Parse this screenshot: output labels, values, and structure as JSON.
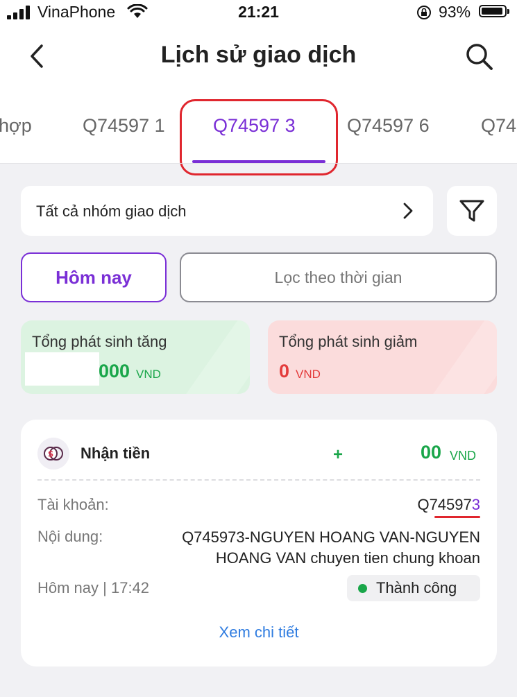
{
  "status_bar": {
    "carrier": "VinaPhone",
    "time": "21:21",
    "battery": "93%",
    "battery_level": 0.93,
    "icons": [
      "signal-icon",
      "wifi-icon",
      "orientation-lock-icon",
      "battery-icon"
    ]
  },
  "header": {
    "title": "Lịch sử giao dịch",
    "back_icon": "chevron-left-icon",
    "search_icon": "search-icon"
  },
  "tabs": [
    {
      "label": "hợp",
      "active": false
    },
    {
      "label": "Q74597 1",
      "active": false
    },
    {
      "label": "Q74597 3",
      "active": true
    },
    {
      "label": "Q74597 6",
      "active": false
    },
    {
      "label": "Q74",
      "active": false
    }
  ],
  "filters": {
    "group_label": "Tất cả nhóm giao dịch",
    "filter_icon": "funnel-icon",
    "today_label": "Hôm nay",
    "time_range_label": "Lọc theo thời gian"
  },
  "summary": {
    "increase": {
      "label": "Tổng phát sinh tăng",
      "value_visible": "000",
      "unit": "VND"
    },
    "decrease": {
      "label": "Tổng phát sinh giảm",
      "value": "0",
      "unit": "VND"
    }
  },
  "transaction": {
    "type": "Nhận tiền",
    "icon": "money-transfer-icon",
    "amount_sign": "+",
    "amount_visible": "00",
    "unit": "VND",
    "account_label": "Tài khoản:",
    "account_value": "Q74597",
    "account_suffix": "3",
    "content_label": "Nội dung:",
    "content_value": "Q745973-NGUYEN HOANG VAN-NGUYEN HOANG VAN chuyen tien chung khoan",
    "time": "Hôm nay | 17:42",
    "status": "Thành công",
    "status_color": "#1aa64a",
    "detail_link": "Xem chi tiết"
  },
  "colors": {
    "accent": "#7a2fd6",
    "success": "#1aa64a",
    "danger": "#e33b3b",
    "link": "#2f7ce0",
    "annotation_red": "#e0262e"
  }
}
